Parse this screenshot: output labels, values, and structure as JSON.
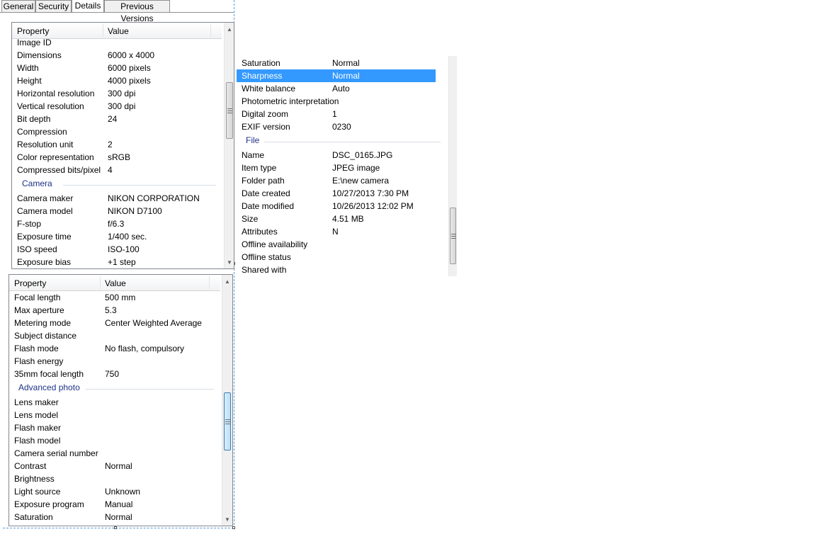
{
  "tabs": [
    "General",
    "Security",
    "Details",
    "Previous Versions"
  ],
  "header": {
    "property": "Property",
    "value": "Value"
  },
  "panel1": {
    "rows": [
      {
        "k": "Image ID",
        "v": ""
      },
      {
        "k": "Dimensions",
        "v": "6000 x 4000"
      },
      {
        "k": "Width",
        "v": "6000 pixels"
      },
      {
        "k": "Height",
        "v": "4000 pixels"
      },
      {
        "k": "Horizontal resolution",
        "v": "300 dpi"
      },
      {
        "k": "Vertical resolution",
        "v": "300 dpi"
      },
      {
        "k": "Bit depth",
        "v": "24"
      },
      {
        "k": "Compression",
        "v": ""
      },
      {
        "k": "Resolution unit",
        "v": "2"
      },
      {
        "k": "Color representation",
        "v": "sRGB"
      },
      {
        "k": "Compressed bits/pixel",
        "v": "4"
      }
    ],
    "group": "Camera",
    "rows2": [
      {
        "k": "Camera maker",
        "v": "NIKON CORPORATION"
      },
      {
        "k": "Camera model",
        "v": "NIKON D7100"
      },
      {
        "k": "F-stop",
        "v": "f/6.3"
      },
      {
        "k": "Exposure time",
        "v": "1/400 sec."
      },
      {
        "k": "ISO speed",
        "v": "ISO-100"
      },
      {
        "k": "Exposure bias",
        "v": "+1 step"
      }
    ]
  },
  "panel2": {
    "rows": [
      {
        "k": "Focal length",
        "v": "500 mm"
      },
      {
        "k": "Max aperture",
        "v": "5.3"
      },
      {
        "k": "Metering mode",
        "v": "Center Weighted Average"
      },
      {
        "k": "Subject distance",
        "v": ""
      },
      {
        "k": "Flash mode",
        "v": "No flash, compulsory"
      },
      {
        "k": "Flash energy",
        "v": ""
      },
      {
        "k": "35mm focal length",
        "v": "750"
      }
    ],
    "group": "Advanced photo",
    "rows2": [
      {
        "k": "Lens maker",
        "v": ""
      },
      {
        "k": "Lens model",
        "v": ""
      },
      {
        "k": "Flash maker",
        "v": ""
      },
      {
        "k": "Flash model",
        "v": ""
      },
      {
        "k": "Camera serial number",
        "v": ""
      },
      {
        "k": "Contrast",
        "v": "Normal"
      },
      {
        "k": "Brightness",
        "v": ""
      },
      {
        "k": "Light source",
        "v": "Unknown"
      },
      {
        "k": "Exposure program",
        "v": "Manual"
      },
      {
        "k": "Saturation",
        "v": "Normal"
      }
    ]
  },
  "panel3": {
    "rows": [
      {
        "k": "Saturation",
        "v": "Normal"
      },
      {
        "k": "Sharpness",
        "v": "Normal",
        "selected": true
      },
      {
        "k": "White balance",
        "v": "Auto"
      },
      {
        "k": "Photometric interpretation",
        "v": ""
      },
      {
        "k": "Digital zoom",
        "v": "1"
      },
      {
        "k": "EXIF version",
        "v": "0230"
      }
    ],
    "group": "File",
    "rows2": [
      {
        "k": "Name",
        "v": "DSC_0165.JPG"
      },
      {
        "k": "Item type",
        "v": "JPEG image"
      },
      {
        "k": "Folder path",
        "v": "E:\\new camera"
      },
      {
        "k": "Date created",
        "v": "10/27/2013 7:30 PM"
      },
      {
        "k": "Date modified",
        "v": "10/26/2013 12:02 PM"
      },
      {
        "k": "Size",
        "v": "4.51 MB"
      },
      {
        "k": "Attributes",
        "v": "N"
      },
      {
        "k": "Offline availability",
        "v": ""
      },
      {
        "k": "Offline status",
        "v": ""
      },
      {
        "k": "Shared with",
        "v": ""
      }
    ]
  },
  "icons": {
    "up": "scroll-up-arrow-icon",
    "down": "scroll-down-arrow-icon"
  },
  "colors": {
    "selection": "#3399ff",
    "group_text": "#1e3287",
    "dash": "#5b9bd5"
  }
}
